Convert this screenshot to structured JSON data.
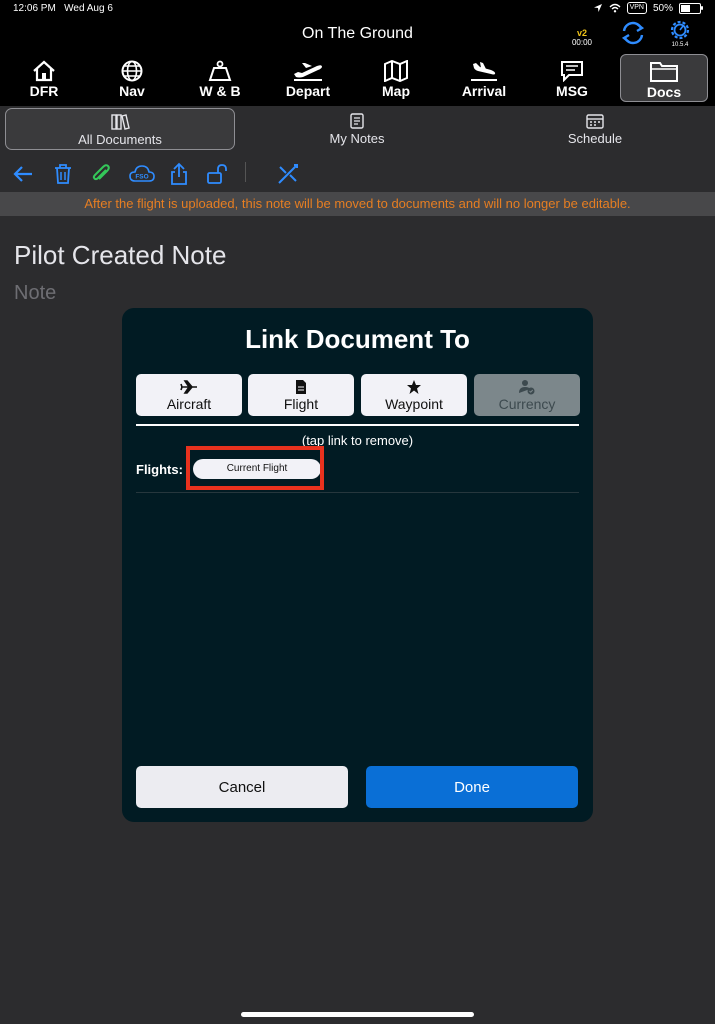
{
  "status_bar": {
    "time": "12:06 PM",
    "date": "Wed Aug 6",
    "vpn": "VPN",
    "battery": "50%"
  },
  "header": {
    "title": "On The Ground",
    "version_badge": "v2",
    "version_time": "00:00",
    "app_version": "10.5.4"
  },
  "main_nav": [
    {
      "label": "DFR",
      "icon": "home-icon"
    },
    {
      "label": "Nav",
      "icon": "globe-icon"
    },
    {
      "label": "W & B",
      "icon": "weight-icon"
    },
    {
      "label": "Depart",
      "icon": "plane-takeoff-icon"
    },
    {
      "label": "Map",
      "icon": "map-icon"
    },
    {
      "label": "Arrival",
      "icon": "plane-landing-icon"
    },
    {
      "label": "MSG",
      "icon": "message-icon"
    },
    {
      "label": "Docs",
      "icon": "folder-icon",
      "active": true
    }
  ],
  "sub_tabs": [
    {
      "label": "All Documents",
      "active": true
    },
    {
      "label": "My Notes"
    },
    {
      "label": "Schedule"
    }
  ],
  "toolbar_icons": [
    "back-arrow-icon",
    "trash-icon",
    "paperclip-icon",
    "fso-cloud-icon",
    "share-icon",
    "unlock-icon",
    "unlink-icon"
  ],
  "fso_label": "FSO",
  "banner": "After the flight is uploaded, this note will be moved to documents and will no longer be editable.",
  "document": {
    "title": "Pilot Created Note",
    "subtitle": "Note"
  },
  "dialog": {
    "title": "Link Document To",
    "segments": [
      {
        "label": "Aircraft",
        "icon": "airplane-icon"
      },
      {
        "label": "Flight",
        "icon": "document-icon"
      },
      {
        "label": "Waypoint",
        "icon": "star-icon"
      },
      {
        "label": "Currency",
        "icon": "person-check-icon",
        "disabled": true
      }
    ],
    "hint": "(tap link to remove)",
    "flights_label": "Flights:",
    "flight_chip": "Current Flight",
    "cancel_label": "Cancel",
    "done_label": "Done"
  },
  "colors": {
    "accent_blue": "#0a6fd6",
    "banner_text": "#e67e22",
    "highlight": "#e8321e",
    "dialog_bg": "#011b23"
  }
}
